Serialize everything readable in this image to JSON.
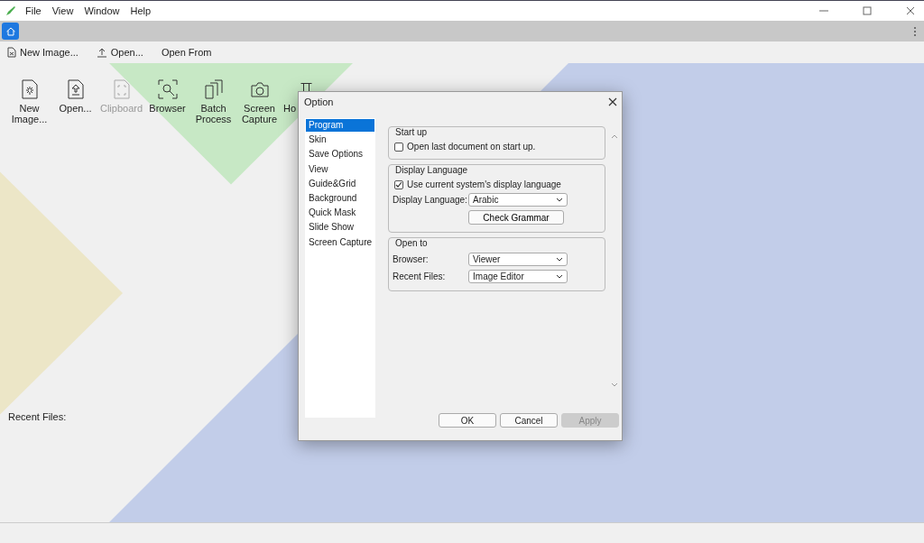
{
  "menu": [
    "File",
    "View",
    "Window",
    "Help"
  ],
  "tabs": [
    {
      "kind": "home",
      "selected": true
    }
  ],
  "toolbar": [
    {
      "kind": "new",
      "label": "New Image..."
    },
    {
      "kind": "upload",
      "label": "Open..."
    },
    {
      "kind": "none",
      "label": "Open From"
    }
  ],
  "launcher": [
    {
      "kind": "new",
      "label": "New Image...",
      "disabled": false
    },
    {
      "kind": "open",
      "label": "Open...",
      "disabled": false
    },
    {
      "kind": "clipboard",
      "label": "Clipboard",
      "disabled": true
    },
    {
      "kind": "browser",
      "label": "Browser",
      "disabled": false
    },
    {
      "kind": "batch",
      "label": "Batch Process",
      "disabled": false
    },
    {
      "kind": "camera",
      "label": "Screen Capture",
      "disabled": false
    },
    {
      "kind": "pi",
      "label": "Ho",
      "disabled": false
    }
  ],
  "recent_files_label": "Recent Files:",
  "dialog": {
    "title": "Option",
    "categories": [
      {
        "label": "Program",
        "selected": true
      },
      {
        "label": "Skin",
        "selected": false
      },
      {
        "label": "Save Options",
        "selected": false
      },
      {
        "label": "View",
        "selected": false
      },
      {
        "label": "Guide&Grid",
        "selected": false
      },
      {
        "label": "Background",
        "selected": false
      },
      {
        "label": "Quick Mask",
        "selected": false
      },
      {
        "label": "Slide Show",
        "selected": false
      },
      {
        "label": "Screen Capture",
        "selected": false
      }
    ],
    "groups": [
      {
        "title": "Start up",
        "items": [
          {
            "kind": "checkbox",
            "label": "Open last document on start up.",
            "checked": false
          }
        ]
      },
      {
        "title": "Display Language",
        "items": [
          {
            "kind": "checkbox",
            "label": "Use current system's display language",
            "checked": true
          },
          {
            "kind": "select",
            "label": "Display Language:",
            "value": "Arabic"
          },
          {
            "kind": "button",
            "label": "Check Grammar"
          }
        ]
      },
      {
        "title": "Open to",
        "items": [
          {
            "kind": "select",
            "label": "Browser:",
            "value": "Viewer"
          },
          {
            "kind": "select",
            "label": "Recent Files:",
            "value": "Image Editor"
          }
        ]
      }
    ],
    "buttons": [
      {
        "label": "OK",
        "disabled": false
      },
      {
        "label": "Cancel",
        "disabled": false
      },
      {
        "label": "Apply",
        "disabled": true
      }
    ]
  }
}
